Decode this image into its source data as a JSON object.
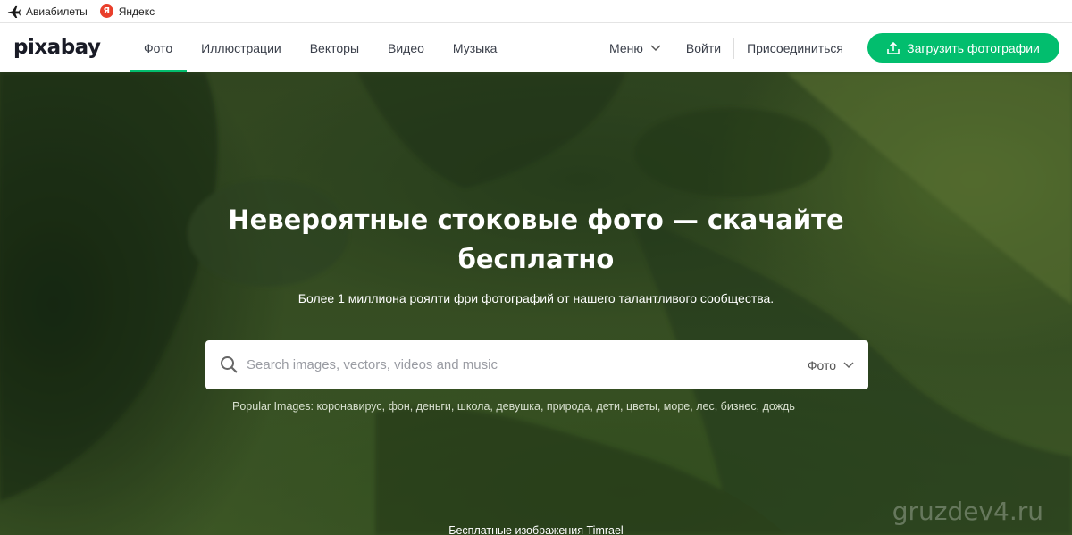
{
  "bookmarks": [
    {
      "label": "Авиабилеты",
      "icon": "airplane-icon"
    },
    {
      "label": "Яндекс",
      "icon": "yandex-icon"
    }
  ],
  "header": {
    "logo": "pixabay",
    "nav": [
      {
        "label": "Фото",
        "active": true
      },
      {
        "label": "Иллюстрации"
      },
      {
        "label": "Векторы"
      },
      {
        "label": "Видео"
      },
      {
        "label": "Музыка"
      }
    ],
    "menu_label": "Меню",
    "login_label": "Войти",
    "join_label": "Присоединиться",
    "upload_label": "Загрузить фотографии"
  },
  "hero": {
    "title_line1": "Невероятные стоковые фото — скачайте",
    "title_line2": "бесплатно",
    "subtitle": "Более 1 миллиона роялти фри фотографий от нашего талантливого сообщества.",
    "search": {
      "placeholder": "Search images, vectors, videos and music",
      "value": "",
      "type_label": "Фото"
    },
    "popular_label": "Popular Images:",
    "popular_tags": [
      "коронавирус",
      "фон",
      "деньги",
      "школа",
      "девушка",
      "природа",
      "дети",
      "цветы",
      "море",
      "лес",
      "бизнес",
      "дождь"
    ],
    "credit": "Бесплатные изображения Timrael",
    "watermark": "gruzdev4.ru"
  },
  "colors": {
    "accent": "#02be6e",
    "nav_text": "#3a3f4a"
  }
}
